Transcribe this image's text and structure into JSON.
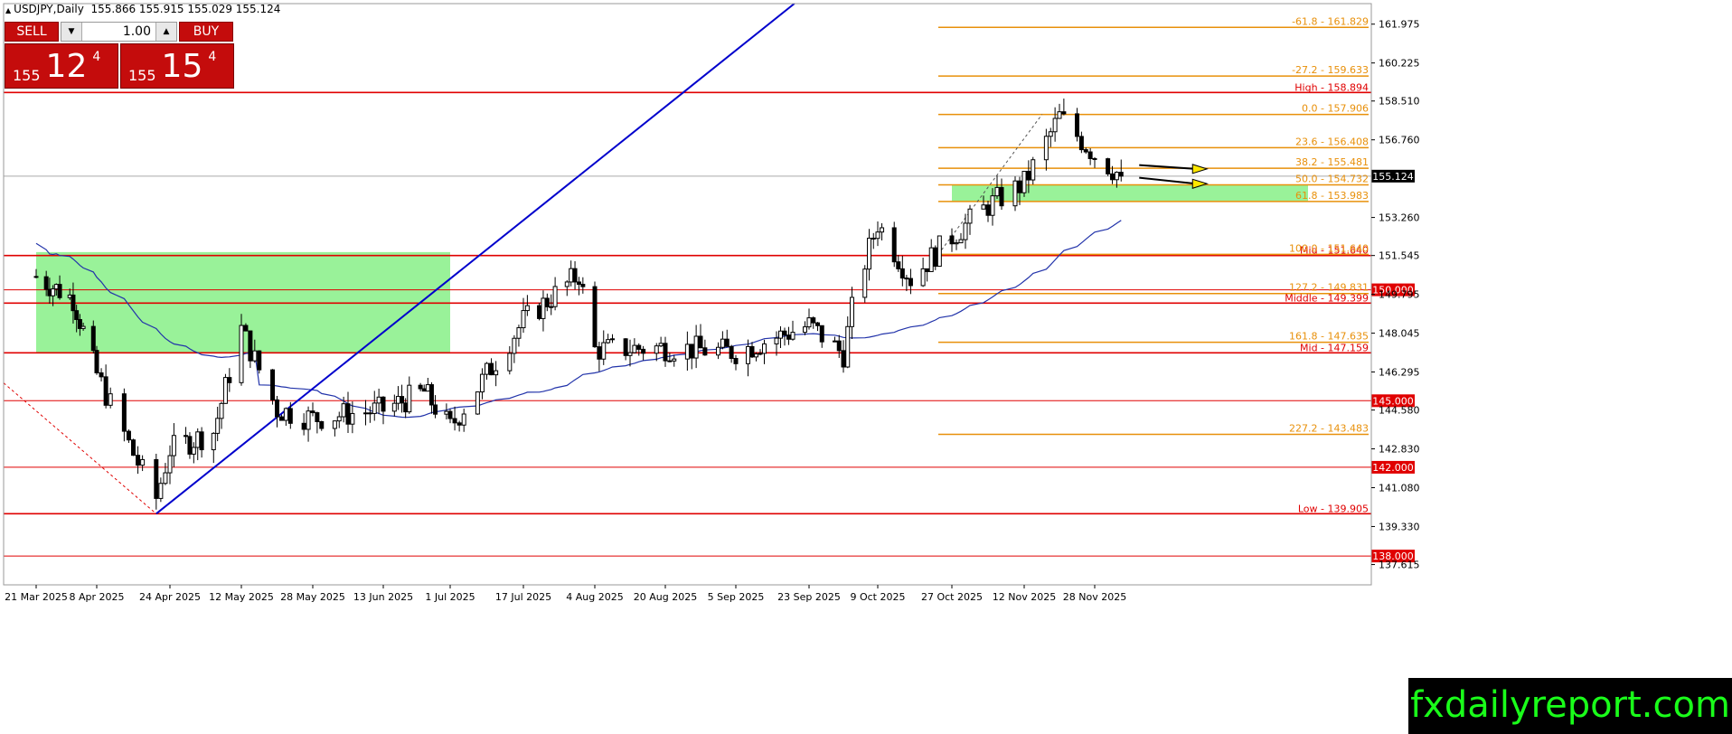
{
  "header": {
    "symbol": "USDJPY,Daily",
    "ohlc": "155.866 155.915 155.029 155.124"
  },
  "trade_panel": {
    "sell_label": "SELL",
    "buy_label": "BUY",
    "lot": "1.00",
    "sell_prefix": "155",
    "sell_main": "12",
    "sell_sup": "4",
    "buy_prefix": "155",
    "buy_main": "15",
    "buy_sup": "4"
  },
  "brand": "fxdailyreport.com",
  "colors": {
    "red": "#e00000",
    "orange": "#e8900a",
    "blue": "#0000cc",
    "ma": "#2233aa",
    "zone": "#99f299",
    "current": "#000000"
  },
  "chart_data": {
    "type": "candlestick",
    "symbol": "USDJPY",
    "timeframe": "Daily",
    "ylim": [
      136.7,
      162.9
    ],
    "y_ticks": [
      "161.975",
      "160.225",
      "158.510",
      "156.760",
      "155.124",
      "153.260",
      "151.545",
      "149.795",
      "148.045",
      "146.295",
      "144.580",
      "142.830",
      "141.080",
      "139.330",
      "137.615"
    ],
    "x_ticks": [
      "21 Mar 2025",
      "8 Apr 2025",
      "24 Apr 2025",
      "12 May 2025",
      "28 May 2025",
      "13 Jun 2025",
      "1 Jul 2025",
      "17 Jul 2025",
      "4 Aug 2025",
      "20 Aug 2025",
      "5 Sep 2025",
      "23 Sep 2025",
      "9 Oct 2025",
      "27 Oct 2025",
      "12 Nov 2025",
      "28 Nov 2025"
    ],
    "current_price": "155.124",
    "levels": [
      {
        "price": 158.894,
        "label": "High - 158.894",
        "color": "red",
        "boxed": false
      },
      {
        "price": 151.545,
        "label": "Mid - 151.640",
        "color": "red",
        "boxed": false
      },
      {
        "price": 150.0,
        "label": "150.000",
        "color": "red",
        "boxed": true
      },
      {
        "price": 149.399,
        "label": "Middle - 149.399",
        "color": "red",
        "boxed": false
      },
      {
        "price": 147.159,
        "label": "Mid - 147.159",
        "color": "red",
        "boxed": false
      },
      {
        "price": 145.0,
        "label": "145.000",
        "color": "red",
        "boxed": true
      },
      {
        "price": 142.0,
        "label": "142.000",
        "color": "red",
        "boxed": true
      },
      {
        "price": 139.905,
        "label": "Low - 139.905",
        "color": "red",
        "boxed": false
      },
      {
        "price": 138.0,
        "label": "138.000",
        "color": "red",
        "boxed": true
      }
    ],
    "fibonacci": [
      {
        "price": 161.829,
        "label": "-61.8 - 161.829"
      },
      {
        "price": 159.633,
        "label": "-27.2 - 159.633"
      },
      {
        "price": 157.906,
        "label": "0.0 - 157.906"
      },
      {
        "price": 156.408,
        "label": "23.6 - 156.408"
      },
      {
        "price": 155.481,
        "label": "38.2 - 155.481"
      },
      {
        "price": 154.732,
        "label": "50.0 - 154.732"
      },
      {
        "price": 153.983,
        "label": "61.8 - 153.983"
      },
      {
        "price": 151.6,
        "label": "100.0 - 151.640"
      },
      {
        "price": 149.831,
        "label": "127.2 - 149.831"
      },
      {
        "price": 147.635,
        "label": "161.8 - 147.635"
      },
      {
        "price": 143.483,
        "label": "227.2 - 143.483"
      }
    ],
    "zones": [
      {
        "from": "21 Mar 2025",
        "to": "1 Jul 2025",
        "low": 147.159,
        "high": 151.7
      },
      {
        "from": "27 Oct 2025",
        "to": "end",
        "low": 153.983,
        "high": 154.732
      }
    ],
    "candles_monthly_path": [
      {
        "date": "21 Mar 2025",
        "price": 150.6
      },
      {
        "date": "1 Apr 2025",
        "price": 149.6
      },
      {
        "date": "8 Apr 2025",
        "price": 146.2
      },
      {
        "date": "16 Apr 2025",
        "price": 142.6
      },
      {
        "date": "21 Apr 2025",
        "price": 140.6
      },
      {
        "date": "24 Apr 2025",
        "price": 142.8
      },
      {
        "date": "5 May 2025",
        "price": 143.6
      },
      {
        "date": "12 May 2025",
        "price": 148.2
      },
      {
        "date": "20 May 2025",
        "price": 144.6
      },
      {
        "date": "28 May 2025",
        "price": 144.2
      },
      {
        "date": "13 Jun 2025",
        "price": 144.6
      },
      {
        "date": "24 Jun 2025",
        "price": 145.4
      },
      {
        "date": "1 Jul 2025",
        "price": 143.8
      },
      {
        "date": "17 Jul 2025",
        "price": 148.6
      },
      {
        "date": "31 Jul 2025",
        "price": 150.7
      },
      {
        "date": "4 Aug 2025",
        "price": 147.3
      },
      {
        "date": "20 Aug 2025",
        "price": 147.4
      },
      {
        "date": "5 Sep 2025",
        "price": 147.2
      },
      {
        "date": "23 Sep 2025",
        "price": 148.4
      },
      {
        "date": "1 Oct 2025",
        "price": 147.1
      },
      {
        "date": "4 Oct 2025",
        "price": 150.1
      },
      {
        "date": "9 Oct 2025",
        "price": 153.0
      },
      {
        "date": "17 Oct 2025",
        "price": 150.5
      },
      {
        "date": "27 Oct 2025",
        "price": 152.4
      },
      {
        "date": "4 Nov 2025",
        "price": 153.8
      },
      {
        "date": "12 Nov 2025",
        "price": 154.8
      },
      {
        "date": "20 Nov 2025",
        "price": 157.8
      },
      {
        "date": "28 Nov 2025",
        "price": 156.1
      },
      {
        "date": "4 Dec 2025",
        "price": 155.124
      }
    ]
  }
}
